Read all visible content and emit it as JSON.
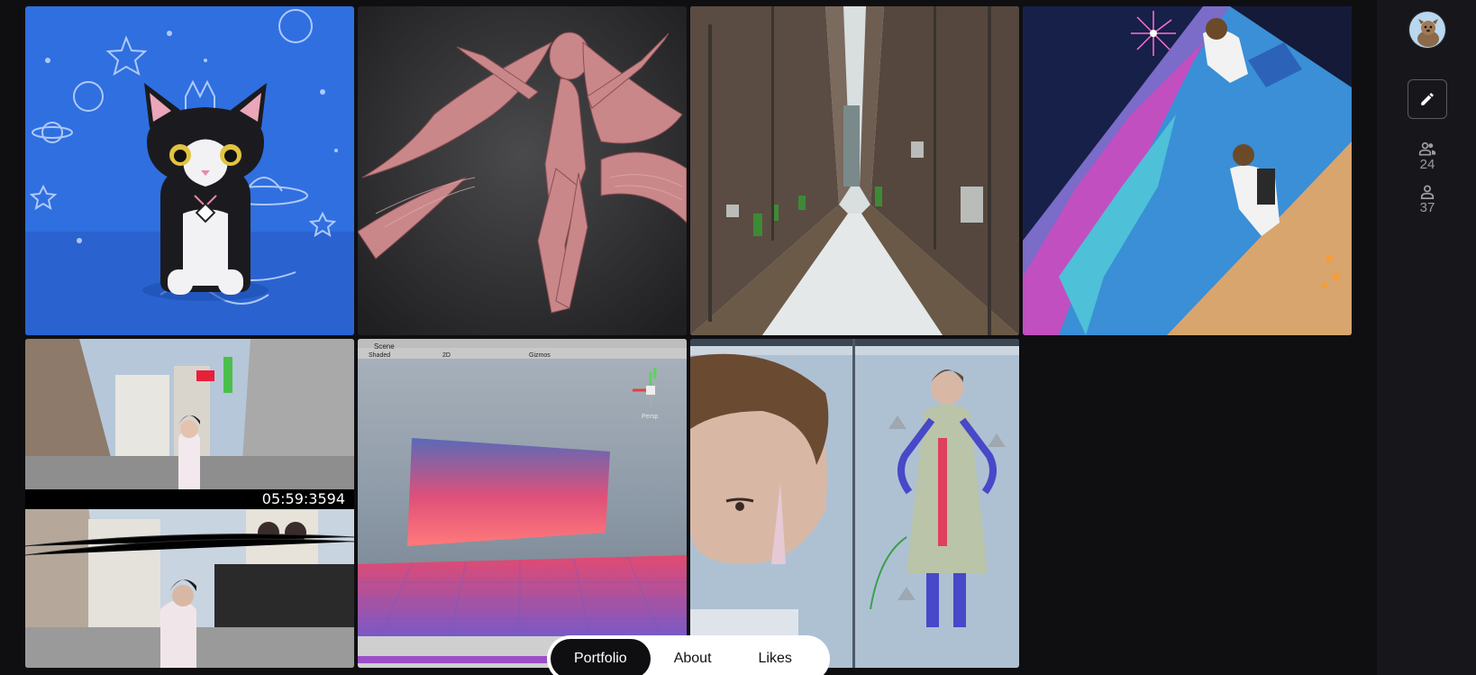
{
  "gallery": {
    "items": [
      {
        "name": "cat-figure-artwork"
      },
      {
        "name": "3d-character-sculpt"
      },
      {
        "name": "city-canal-render"
      },
      {
        "name": "anime-city-illustration"
      },
      {
        "name": "street-scene-video",
        "timestamp": "05:59:3594"
      },
      {
        "name": "unity-scene-screenshot",
        "scene_tab": "Scene",
        "shading_mode": "Shaded",
        "view_2d": "2D",
        "gizmos": "Gizmos",
        "persp_label": "Persp"
      },
      {
        "name": "character-modeling-screenshot"
      }
    ]
  },
  "sidebar": {
    "avatar_icon": "dog-avatar",
    "edit_icon": "pencil-icon",
    "followers_count": "24",
    "following_count": "37"
  },
  "tabs": [
    {
      "label": "Portfolio",
      "active": true
    },
    {
      "label": "About",
      "active": false
    },
    {
      "label": "Likes",
      "active": false
    }
  ],
  "colors": {
    "background": "#0f0f12",
    "sidebar": "#17171b",
    "tab_active": "#0f0f12",
    "tab_bar": "#ffffff"
  }
}
